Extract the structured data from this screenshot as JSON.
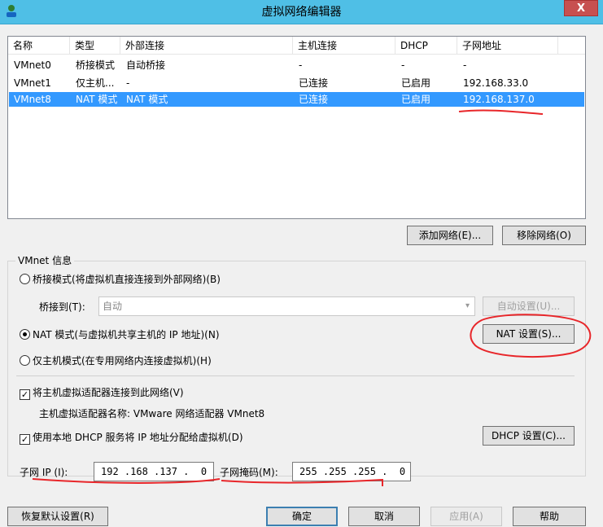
{
  "window": {
    "title": "虚拟网络编辑器",
    "close_label": "X"
  },
  "networks": {
    "columns": [
      "名称",
      "类型",
      "外部连接",
      "主机连接",
      "DHCP",
      "子网地址"
    ],
    "rows": [
      [
        "VMnet0",
        "桥接模式",
        "自动桥接",
        "-",
        "-",
        "-"
      ],
      [
        "VMnet1",
        "仅主机...",
        "-",
        "已连接",
        "已启用",
        "192.168.33.0"
      ],
      [
        "VMnet8",
        "NAT 模式",
        "NAT 模式",
        "已连接",
        "已启用",
        "192.168.137.0"
      ]
    ],
    "selected_row": 2
  },
  "list_buttons": {
    "add": "添加网络(E)...",
    "remove": "移除网络(O)"
  },
  "vmnet_info": {
    "title": "VMnet 信息",
    "bridged_radio": "桥接模式(将虚拟机直接连接到外部网络)(B)",
    "bridge_to_label": "桥接到(T):",
    "bridge_to_value": "自动",
    "auto_settings": "自动设置(U)...",
    "nat_radio": "NAT 模式(与虚拟机共享主机的 IP 地址)(N)",
    "nat_settings": "NAT 设置(S)...",
    "hostonly_radio": "仅主机模式(在专用网络内连接虚拟机)(H)",
    "selected_mode": "nat",
    "connect_adapter_check": "将主机虚拟适配器连接到此网络(V)",
    "connect_adapter_checked": true,
    "adapter_name": "主机虚拟适配器名称: VMware 网络适配器 VMnet8",
    "dhcp_check": "使用本地 DHCP 服务将 IP 地址分配给虚拟机(D)",
    "dhcp_checked": true,
    "dhcp_settings": "DHCP 设置(C)...",
    "subnet_ip_label": "子网 IP (I):",
    "subnet_ip_value": "192 .168 .137 .  0",
    "subnet_mask_label": "子网掩码(M):",
    "subnet_mask_value": "255 .255 .255 .  0"
  },
  "footer": {
    "restore_defaults": "恢复默认设置(R)",
    "ok": "确定",
    "cancel": "取消",
    "apply": "应用(A)",
    "help": "帮助"
  },
  "colors": {
    "titlebar": "#4fbfe6",
    "selection": "#3399ff",
    "annotation": "#e8262a",
    "close": "#c75050"
  }
}
